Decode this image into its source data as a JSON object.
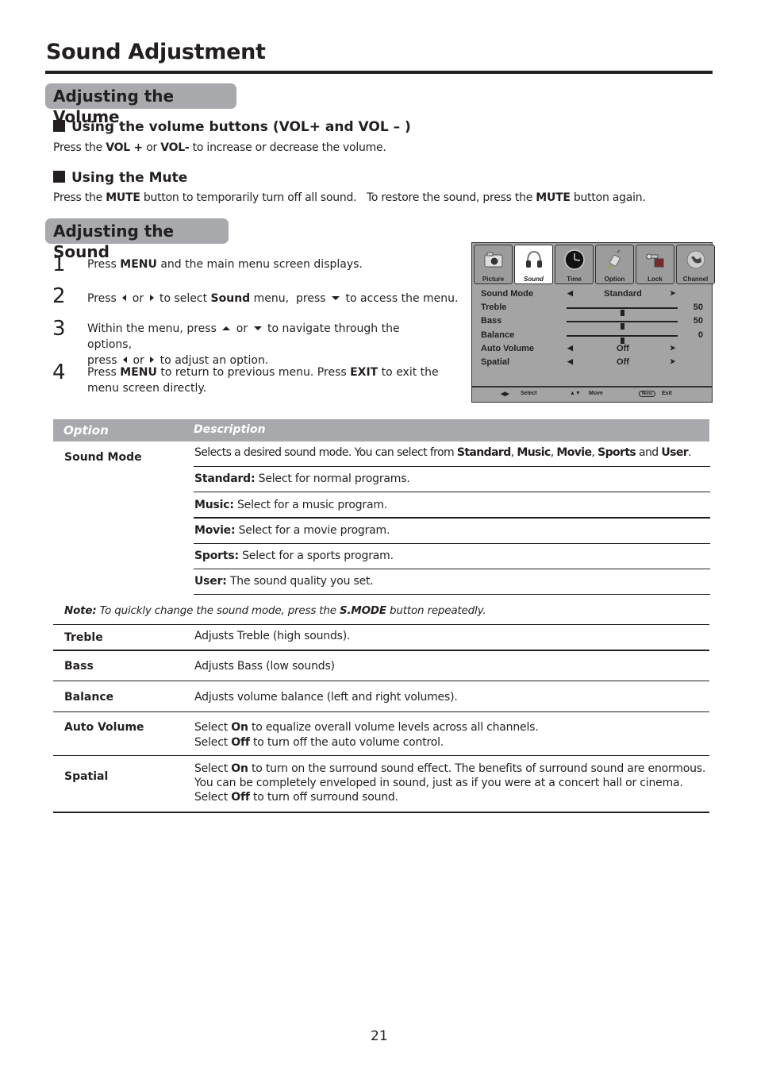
{
  "page": {
    "title": "Sound Adjustment",
    "number": "21"
  },
  "sections": {
    "volume": {
      "heading": "Adjusting the Volume",
      "sub1": {
        "heading": "Using the volume buttons (VOL+ and VOL – )",
        "text_parts": [
          "Press the ",
          "VOL +",
          " or ",
          "VOL-",
          " to increase or decrease the volume."
        ]
      },
      "sub2": {
        "heading": "Using the Mute",
        "text_parts": [
          "Press the ",
          "MUTE",
          " button to temporarily turn off all sound.   To restore the sound, press the ",
          "MUTE",
          " button again."
        ]
      }
    },
    "sound": {
      "heading": "Adjusting the Sound",
      "steps": [
        {
          "num": "1",
          "parts": [
            "Press ",
            "MENU",
            " and the main menu screen displays."
          ]
        },
        {
          "num": "2",
          "parts": [
            "Press ",
            " or ",
            " to select ",
            "Sound",
            " menu,  press ",
            " to access the menu."
          ]
        },
        {
          "num": "3",
          "parts": [
            "Within the menu, press ",
            " or ",
            " to navigate through the options,",
            "press ",
            " or ",
            " to adjust an option."
          ]
        },
        {
          "num": "4",
          "parts": [
            "Press ",
            "MENU",
            " to return to previous menu. Press ",
            "EXIT",
            " to exit the menu screen directly."
          ]
        }
      ]
    }
  },
  "tv_menu": {
    "tabs": [
      {
        "label": "Picture",
        "icon": "camera-icon",
        "active": false
      },
      {
        "label": "Sound",
        "icon": "headphones-icon",
        "active": true
      },
      {
        "label": "Time",
        "icon": "clock-icon",
        "active": false
      },
      {
        "label": "Option",
        "icon": "plug-icon",
        "active": false
      },
      {
        "label": "Lock",
        "icon": "key-lock-icon",
        "active": false
      },
      {
        "label": "Channel",
        "icon": "globe-icon",
        "active": false
      }
    ],
    "rows": [
      {
        "name": "Sound Mode",
        "type": "select",
        "value": "Standard"
      },
      {
        "name": "Treble",
        "type": "slider",
        "value": "50",
        "level": 0.5
      },
      {
        "name": "Bass",
        "type": "slider",
        "value": "50",
        "level": 0.5
      },
      {
        "name": "Balance",
        "type": "slider",
        "value": "0",
        "level": 0.5
      },
      {
        "name": "Auto Volume",
        "type": "select",
        "value": "Off"
      },
      {
        "name": "Spatial",
        "type": "select",
        "value": "Off"
      }
    ],
    "footer": {
      "select": "Select",
      "move": "Move",
      "menu_btn": "Menu",
      "exit": "Exit"
    }
  },
  "table": {
    "headers": {
      "option": "Option",
      "description": "Description"
    },
    "sound_mode": {
      "option": "Sound Mode",
      "intro_parts": [
        "Selects a desired sound mode.  You can select from ",
        "Standard",
        ", ",
        "Music",
        ", ",
        "Movie",
        ", ",
        "Sports",
        " and ",
        "User",
        "."
      ],
      "modes": [
        {
          "name": "Standard:",
          "desc": " Select for normal programs."
        },
        {
          "name": "Music:",
          "desc": " Select for a music program."
        },
        {
          "name": "Movie:",
          "desc": " Select for a movie program."
        },
        {
          "name": "Sports:",
          "desc": " Select for a sports program."
        },
        {
          "name": "User:",
          "desc": " The sound quality you set."
        }
      ]
    },
    "note": {
      "label": "Note:",
      "text1": " To quickly change the sound mode, press the ",
      "key": "S.MODE",
      "text2": " button repeatedly."
    },
    "rows": [
      {
        "option": "Treble",
        "lines": [
          [
            "Adjusts Treble (high sounds)."
          ]
        ]
      },
      {
        "option": "Bass",
        "lines": [
          [
            "Adjusts Bass (low sounds)"
          ]
        ]
      },
      {
        "option": "Balance",
        "lines": [
          [
            "Adjusts volume balance (left and right volumes)."
          ]
        ]
      },
      {
        "option": "Auto Volume",
        "lines": [
          [
            "Select ",
            "On",
            " to equalize overall volume levels across all channels."
          ],
          [
            "Select ",
            "Off",
            " to turn off the auto volume control."
          ]
        ]
      },
      {
        "option": "Spatial",
        "lines": [
          [
            "Select ",
            "On",
            " to turn on the surround sound effect. The benefits of surround sound are enormous."
          ],
          [
            "You can be completely enveloped in sound, just as if you were at a concert hall or cinema."
          ],
          [
            "Select ",
            "Off",
            " to turn off surround sound."
          ]
        ]
      }
    ]
  }
}
